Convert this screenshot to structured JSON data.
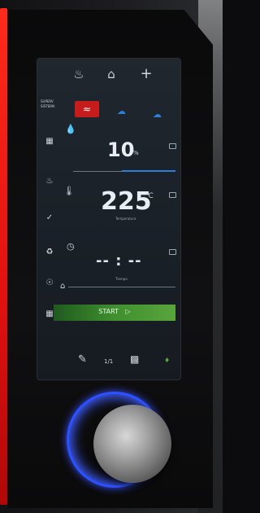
{
  "header": {
    "mode_label_line1": "SUPERV",
    "mode_label_line2": "SISTEMA",
    "icons": [
      "chef-hat-icon",
      "home-icon",
      "plus-icon"
    ]
  },
  "modes": {
    "active_icon": "steam-heat-icon",
    "right_icons": [
      "drop-icon",
      "cloud-icon"
    ]
  },
  "humidity": {
    "value": "10",
    "unit": "%",
    "bar_level": 0.18
  },
  "temperature": {
    "value": "225",
    "unit": "°C",
    "caption": "Temperatura"
  },
  "time": {
    "value": "-- : --",
    "caption": "Tiempo"
  },
  "actions": {
    "start_label": "START"
  },
  "footer": {
    "page": "1/1"
  },
  "colors": {
    "accent_red": "#c71c1c",
    "accent_blue": "#2f7fd8",
    "start_green": "#3f8f2e"
  }
}
